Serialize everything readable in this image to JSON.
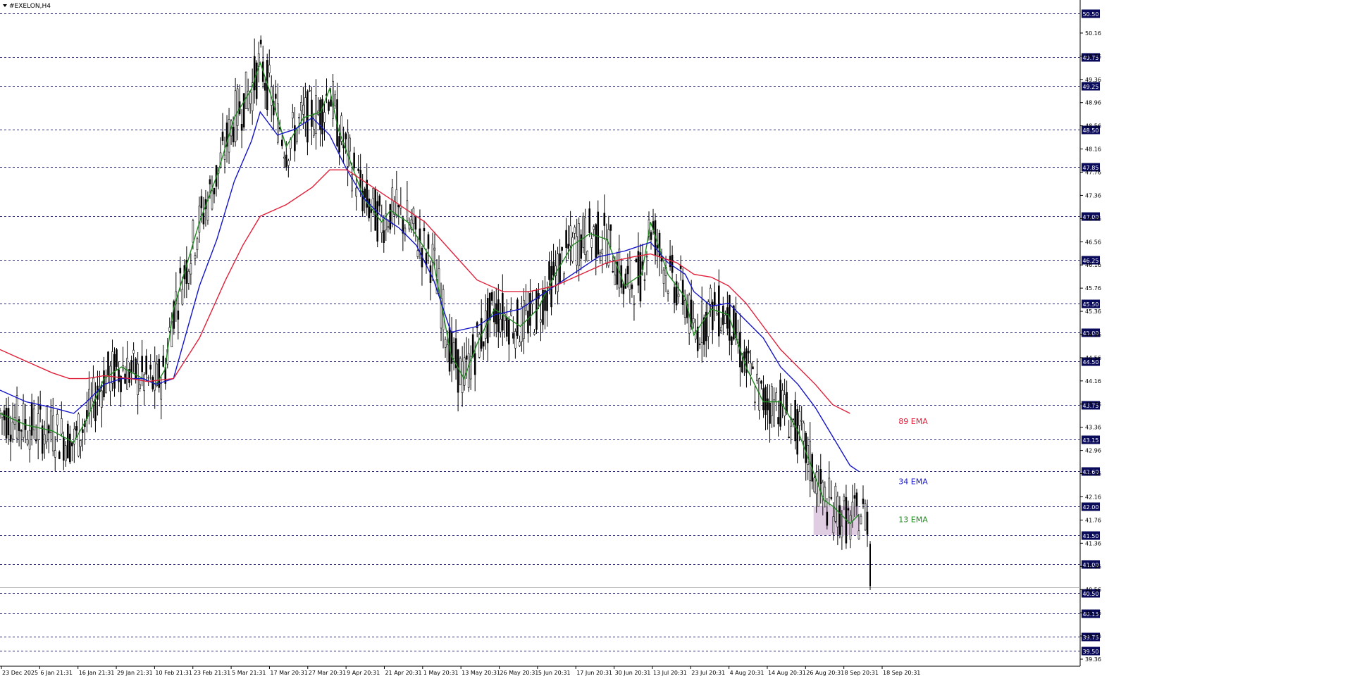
{
  "window": {
    "title": "#EXELON,H4"
  },
  "colors": {
    "ema13": "#1f8a1f",
    "ema34": "#1414c8",
    "ema89": "#e0203a",
    "candles": "#000000",
    "zone": "#d8bfdc",
    "grid": "#2b2b6e",
    "axis_label_bg": "#0a0a5a"
  },
  "chart_data": {
    "type": "line",
    "title": "#EXELON,H4",
    "xlabel": "",
    "ylabel": "",
    "ylim": [
      39.36,
      50.56
    ],
    "grid": true,
    "x_tick_labels": [
      "23 Dec 2025",
      "6 Jan 21:31",
      "16 Jan 21:31",
      "29 Jan 21:31",
      "10 Feb 21:31",
      "23 Feb 21:31",
      "5 Mar 21:31",
      "17 Mar 20:31",
      "27 Mar 20:31",
      "9 Apr 20:31",
      "21 Apr 20:31",
      "1 May 20:31",
      "13 May 20:31",
      "26 May 20:31",
      "5 Jun 20:31",
      "17 Jun 20:31",
      "30 Jun 20:31",
      "13 Jul 20:31",
      "23 Jul 20:31",
      "4 Aug 20:31",
      "14 Aug 20:31",
      "26 Aug 20:31",
      "8 Sep 20:31",
      "18 Sep 20:31"
    ],
    "y_tick_labels": [
      "50.16",
      "49.76",
      "49.36",
      "48.96",
      "48.56",
      "48.16",
      "47.76",
      "47.36",
      "46.96",
      "46.56",
      "46.16",
      "45.76",
      "45.36",
      "44.96",
      "44.56",
      "44.16",
      "43.76",
      "43.36",
      "42.96",
      "42.56",
      "42.16",
      "41.76",
      "41.36",
      "40.96",
      "40.56",
      "40.16",
      "39.76",
      "39.36"
    ],
    "levels": [
      50.5,
      49.75,
      49.25,
      48.5,
      47.85,
      47.0,
      46.25,
      45.5,
      45.0,
      44.5,
      43.75,
      43.15,
      42.6,
      42.0,
      41.5,
      41.0,
      40.5,
      40.15,
      39.75,
      39.5
    ],
    "current_price": 40.6,
    "zone": {
      "low": 41.5,
      "high": 42.0,
      "x_start": 0.938,
      "x_end": 0.99
    },
    "series": [
      {
        "name": "13 EMA",
        "x": [
          0,
          0.03,
          0.06,
          0.085,
          0.1,
          0.12,
          0.14,
          0.165,
          0.18,
          0.19,
          0.2,
          0.23,
          0.25,
          0.27,
          0.29,
          0.3,
          0.31,
          0.33,
          0.35,
          0.37,
          0.38,
          0.39,
          0.42,
          0.44,
          0.45,
          0.47,
          0.5,
          0.52,
          0.535,
          0.55,
          0.57,
          0.6,
          0.62,
          0.64,
          0.66,
          0.68,
          0.7,
          0.72,
          0.74,
          0.75,
          0.77,
          0.79,
          0.8,
          0.82,
          0.84,
          0.86,
          0.88,
          0.9,
          0.92,
          0.94,
          0.95,
          0.96,
          0.97,
          0.98,
          0.99
        ],
        "values": [
          43.6,
          43.4,
          43.3,
          43.1,
          43.5,
          44.2,
          44.4,
          44.2,
          44.1,
          44.35,
          45.4,
          46.9,
          47.7,
          48.7,
          49.2,
          49.65,
          49.2,
          48.2,
          48.7,
          48.8,
          49.2,
          48.5,
          47.3,
          46.9,
          47.1,
          46.9,
          46.2,
          44.6,
          44.2,
          44.8,
          45.4,
          45.1,
          45.4,
          46.0,
          46.5,
          46.7,
          46.6,
          45.8,
          46.0,
          46.9,
          46.0,
          45.6,
          44.95,
          45.4,
          45.3,
          44.4,
          43.8,
          43.8,
          43.3,
          42.5,
          42.1,
          42.0,
          41.85,
          41.7,
          41.85
        ]
      },
      {
        "name": "34 EMA",
        "x": [
          0,
          0.03,
          0.06,
          0.085,
          0.1,
          0.12,
          0.14,
          0.165,
          0.18,
          0.2,
          0.23,
          0.25,
          0.27,
          0.29,
          0.3,
          0.32,
          0.34,
          0.36,
          0.38,
          0.4,
          0.42,
          0.44,
          0.46,
          0.48,
          0.5,
          0.52,
          0.55,
          0.57,
          0.6,
          0.63,
          0.66,
          0.69,
          0.72,
          0.75,
          0.77,
          0.79,
          0.8,
          0.82,
          0.84,
          0.86,
          0.88,
          0.9,
          0.92,
          0.94,
          0.96,
          0.98,
          0.99
        ],
        "values": [
          44.0,
          43.8,
          43.7,
          43.6,
          43.8,
          44.1,
          44.2,
          44.2,
          44.1,
          44.2,
          45.8,
          46.6,
          47.6,
          48.3,
          48.8,
          48.4,
          48.5,
          48.7,
          48.4,
          47.8,
          47.3,
          47.0,
          46.8,
          46.5,
          45.9,
          45.0,
          45.1,
          45.3,
          45.4,
          45.7,
          46.0,
          46.3,
          46.4,
          46.55,
          46.2,
          46.0,
          45.7,
          45.45,
          45.5,
          45.2,
          44.9,
          44.4,
          44.1,
          43.7,
          43.2,
          42.7,
          42.6
        ]
      },
      {
        "name": "89 EMA",
        "x": [
          0,
          0.03,
          0.06,
          0.08,
          0.1,
          0.12,
          0.15,
          0.17,
          0.2,
          0.23,
          0.26,
          0.28,
          0.3,
          0.33,
          0.36,
          0.38,
          0.4,
          0.43,
          0.46,
          0.49,
          0.52,
          0.55,
          0.58,
          0.61,
          0.64,
          0.67,
          0.7,
          0.73,
          0.75,
          0.78,
          0.8,
          0.82,
          0.84,
          0.86,
          0.88,
          0.9,
          0.92,
          0.94,
          0.96,
          0.98
        ],
        "values": [
          44.7,
          44.5,
          44.3,
          44.2,
          44.2,
          44.25,
          44.2,
          44.15,
          44.2,
          44.9,
          45.9,
          46.5,
          47.0,
          47.2,
          47.5,
          47.8,
          47.8,
          47.5,
          47.2,
          46.9,
          46.4,
          45.9,
          45.7,
          45.7,
          45.8,
          46.0,
          46.2,
          46.3,
          46.35,
          46.2,
          46.0,
          45.95,
          45.8,
          45.5,
          45.1,
          44.7,
          44.4,
          44.1,
          43.75,
          43.6
        ]
      }
    ],
    "annotations": [
      {
        "text": "89 EMA",
        "color": "#e0203a"
      },
      {
        "text": "34 EMA",
        "color": "#1414c8"
      },
      {
        "text": "13 EMA",
        "color": "#1f8a1f"
      }
    ]
  }
}
